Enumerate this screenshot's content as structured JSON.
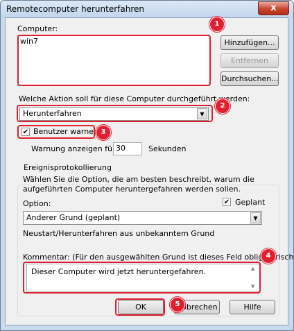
{
  "window": {
    "title": "Remotecomputer herunterfahren",
    "close": "x"
  },
  "computer": {
    "label": "Computer:",
    "value": "win7",
    "add": "Hinzufügen...",
    "remove": "Entfernen",
    "browse": "Durchsuchen..."
  },
  "action": {
    "label": "Welche Aktion soll für diese Computer durchgeführt werden:",
    "value": "Herunterfahren"
  },
  "warn": {
    "check": "✔",
    "label": "Benutzer warnen",
    "time_label": "Warnung anzeigen für",
    "time_value": "30",
    "unit": "Sekunden"
  },
  "events": {
    "legend": "Ereignisprotokollierung",
    "description": "Wählen Sie die Option, die am besten beschreibt, warum die aufgeführten Computer heruntergefahren werden sollen.",
    "option_label": "Option:",
    "planned_check": "✔",
    "planned_label": "Geplant",
    "option_value": "Anderer Grund (geplant)",
    "option_desc": "Neustart/Herunterfahren aus unbekanntem Grund",
    "comment_label": "Kommentar: (Für den ausgewählten Grund ist dieses Feld obligatorisch)",
    "comment_value": "Dieser Computer wird jetzt heruntergefahren."
  },
  "buttons": {
    "ok": "OK",
    "cancel": "Abbrechen",
    "help": "Hilfe"
  },
  "markers": [
    "1",
    "2",
    "3",
    "4",
    "5"
  ],
  "colors": {
    "highlight": "#e0202f",
    "titlebar": "#c2d6ee",
    "dialog": "#f0f0f0"
  }
}
